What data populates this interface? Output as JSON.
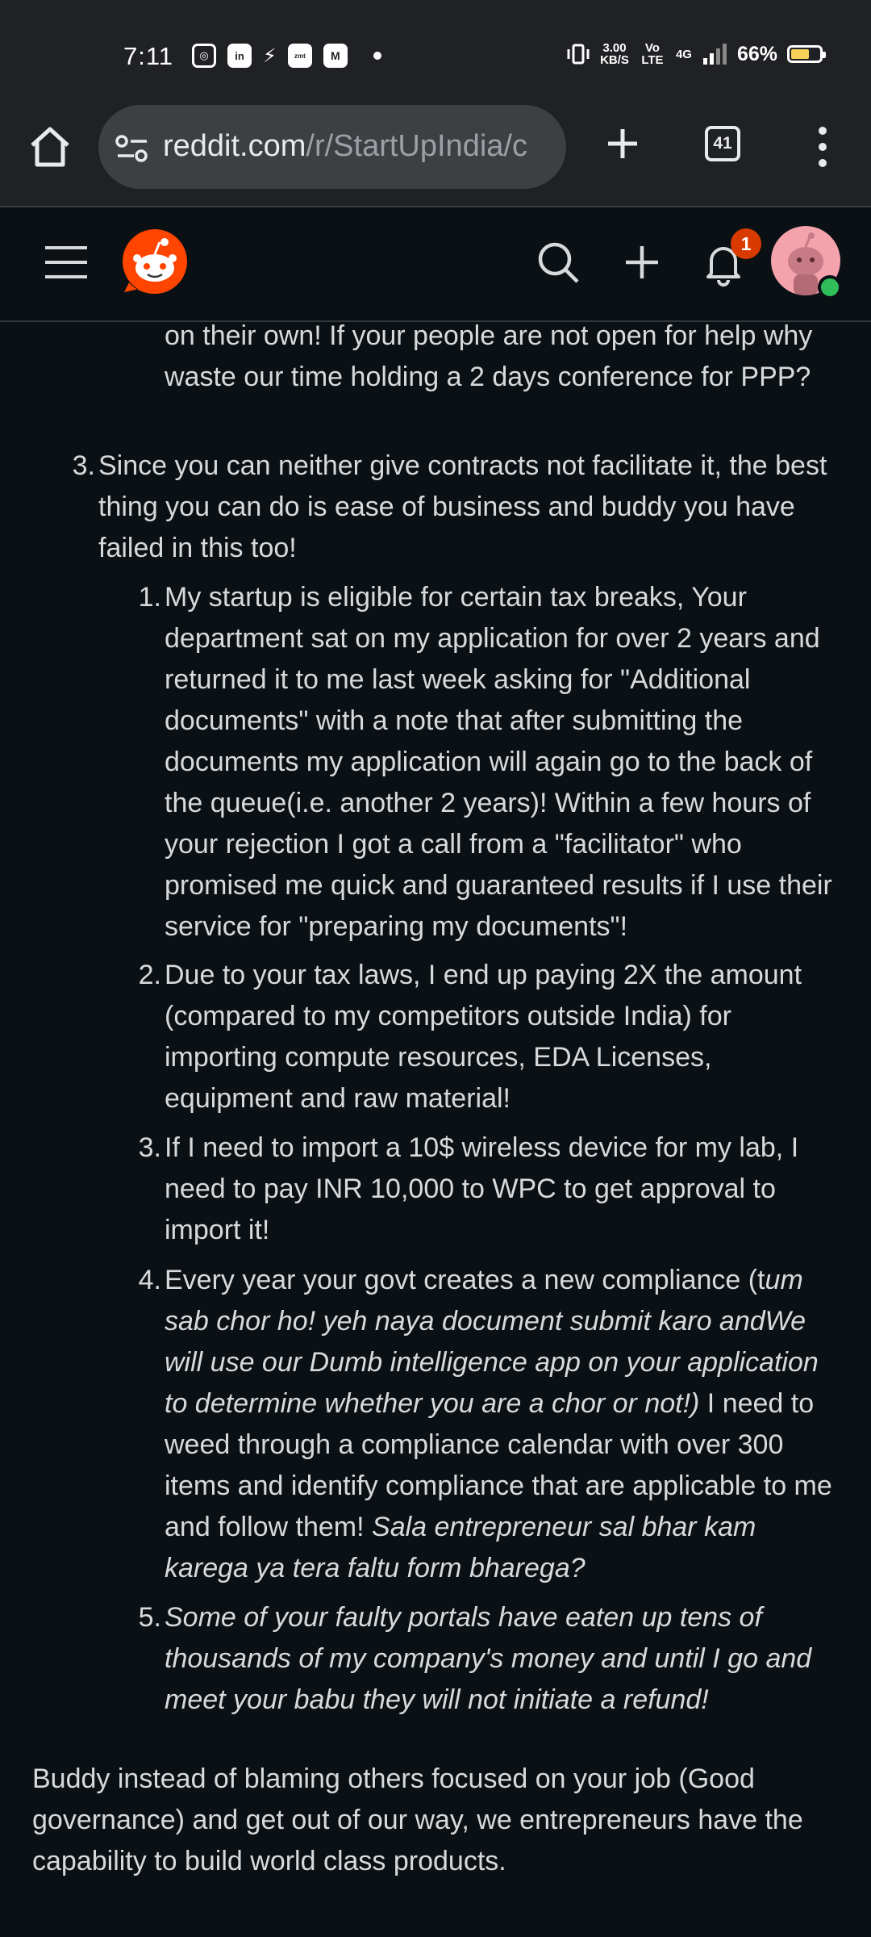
{
  "status_bar": {
    "time": "7:11",
    "data_speed_value": "3.00",
    "data_speed_unit": "KB/S",
    "volte": "Vo LTE",
    "network": "4G",
    "battery_percent": "66%",
    "battery_level": 0.66,
    "notification_icons": [
      "instagram-icon",
      "linkedin-icon",
      "flash-icon",
      "zomato-icon",
      "myntra-icon"
    ]
  },
  "browser": {
    "url_host": "reddit.com",
    "url_path": "/r/StartUpIndia/c",
    "tab_count": "41"
  },
  "reddit_header": {
    "notification_count": "1"
  },
  "comment": {
    "fragment_top": "on their own! If your people are not open for help why waste our time holding a 2 days conference for PPP?",
    "item3": {
      "number": "3.",
      "text": "Since you can neither give contracts not facilitate it, the best thing you can do is ease of business and buddy you have failed in this too!",
      "sub": [
        {
          "number": "1.",
          "text": "My startup is eligible for certain tax breaks, Your department sat on my application for over 2 years and returned it to me last week asking for \"Additional documents\" with a note that after submitting the documents my application will again go to the back of the queue(i.e. another 2 years)! Within a few hours of your rejection I got a call from a \"facilitator\" who promised me quick and guaranteed results if I use their service for \"preparing my documents\"!"
        },
        {
          "number": "2.",
          "text": "Due to your tax laws, I end up paying 2X the amount (compared to my competitors outside India) for importing compute resources, EDA Licenses, equipment and raw material!"
        },
        {
          "number": "3.",
          "text": "If I need to import a 10$ wireless device for my lab, I need to pay INR 10,000 to WPC to get approval to import it!"
        },
        {
          "number": "4.",
          "text_a": "Every year your govt creates a new compliance (t",
          "text_b_italic": "um sab chor ho! yeh naya document submit karo andWe will use our Dumb intelligence app on your application to determine whether you are a chor or not!)",
          "text_c": " I need to weed through a compliance calendar with over 300 items and identify compliance that are applicable to me and follow them! ",
          "text_d_italic": "Sala entrepreneur sal bhar kam karega ya tera faltu form bharega?"
        },
        {
          "number": "5.",
          "text_italic": "Some of your faulty portals have eaten up tens of thousands of my company's money and until I go and meet your babu they will not initiate a refund!"
        }
      ]
    },
    "closing": "Buddy instead of blaming others focused on your job (Good governance) and get out of our way, we entrepreneurs have the capability to build world class products."
  }
}
